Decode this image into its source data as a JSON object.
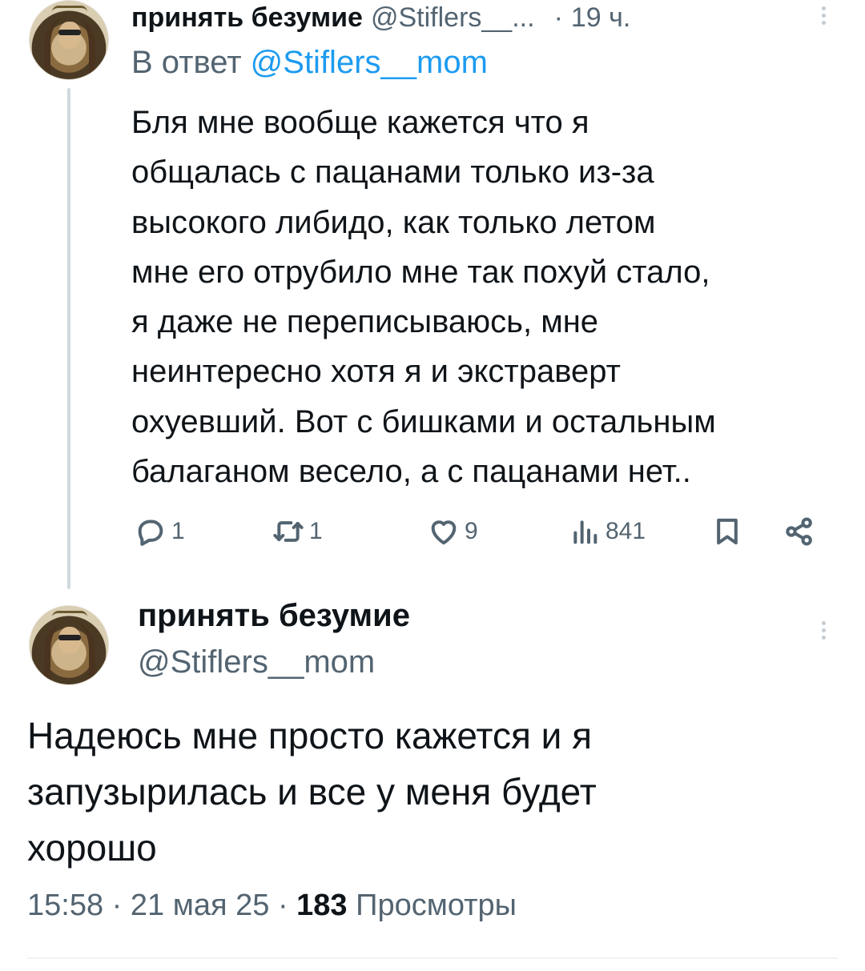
{
  "reply_tweet": {
    "author_name": "принять безумие",
    "author_handle": "@Stiflers__...",
    "separator": "·",
    "time_ago": "19 ч.",
    "reply_prefix": "В ответ",
    "reply_mention": "@Stiflers__mom",
    "text_lines": [
      "Бля мне вообще кажется что я",
      "общалась с пацанами только из-за",
      "высокого либидо, как только летом",
      "мне его отрубило мне так похуй стало,",
      "я даже не переписываюсь, мне",
      "неинтересно хотя я и экстраверт",
      "охуевший. Вот с бишками и остальным",
      "балаганом весело, а с пацанами нет.."
    ],
    "actions": {
      "replies": "1",
      "retweets": "1",
      "likes": "9",
      "views": "841"
    }
  },
  "main_tweet": {
    "author_name": "принять безумие",
    "author_handle": "@Stiflers__mom",
    "text_lines": [
      "Надеюсь мне просто кажется и я",
      "запузырилась и все у меня будет",
      "хорошо"
    ],
    "time": "15:58",
    "sep1": "·",
    "date": "21 мая 25",
    "sep2": "·",
    "views_count": "183",
    "views_label": "Просмотры"
  },
  "icons": {
    "reply": "comment-bubble-icon",
    "retweet": "retweet-arrows-icon",
    "like": "heart-icon",
    "views": "bar-chart-icon",
    "bookmark": "bookmark-icon",
    "share": "share-nodes-icon",
    "more": "more-vertical-icon"
  },
  "colors": {
    "text": "#0f1419",
    "secondary": "#536471",
    "link": "#1d9bf0",
    "thread_line": "#cfd9de"
  }
}
